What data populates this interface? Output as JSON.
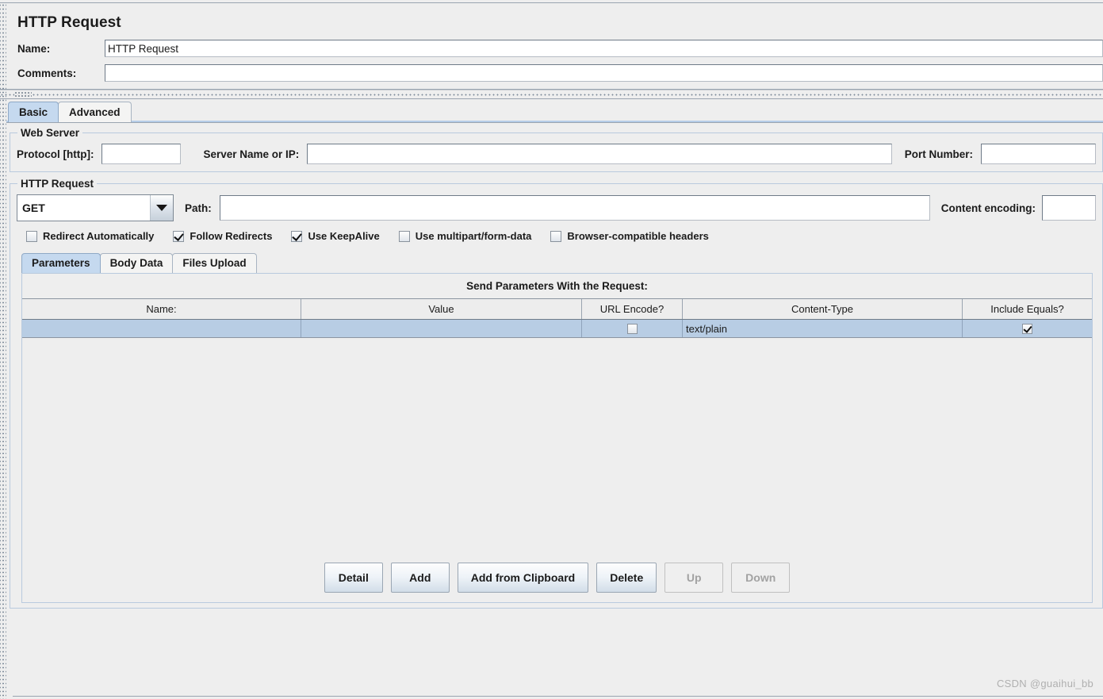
{
  "window": {
    "title": "HTTP Request"
  },
  "header": {
    "name_label": "Name:",
    "name_value": "HTTP Request",
    "comments_label": "Comments:",
    "comments_value": ""
  },
  "main_tabs": [
    {
      "label": "Basic",
      "selected": true
    },
    {
      "label": "Advanced",
      "selected": false
    }
  ],
  "web_server": {
    "legend": "Web Server",
    "protocol_label": "Protocol [http]:",
    "protocol_value": "",
    "server_label": "Server Name or IP:",
    "server_value": "",
    "port_label": "Port Number:",
    "port_value": ""
  },
  "http_request": {
    "legend": "HTTP Request",
    "method_value": "GET",
    "path_label": "Path:",
    "path_value": "",
    "content_encoding_label": "Content encoding:",
    "content_encoding_value": "",
    "checkboxes": [
      {
        "label": "Redirect Automatically",
        "checked": false
      },
      {
        "label": "Follow Redirects",
        "checked": true
      },
      {
        "label": "Use KeepAlive",
        "checked": true
      },
      {
        "label": "Use multipart/form-data",
        "checked": false
      },
      {
        "label": "Browser-compatible headers",
        "checked": false
      }
    ]
  },
  "inner_tabs": [
    {
      "label": "Parameters",
      "selected": true
    },
    {
      "label": "Body Data",
      "selected": false
    },
    {
      "label": "Files Upload",
      "selected": false
    }
  ],
  "parameters_panel": {
    "title": "Send Parameters With the Request:",
    "columns": [
      "Name:",
      "Value",
      "URL Encode?",
      "Content-Type",
      "Include Equals?"
    ],
    "rows": [
      {
        "name": "",
        "value": "",
        "url_encode": false,
        "content_type": "text/plain",
        "include_equals": true,
        "selected": true
      }
    ],
    "buttons": [
      {
        "label": "Detail",
        "enabled": true
      },
      {
        "label": "Add",
        "enabled": true
      },
      {
        "label": "Add from Clipboard",
        "enabled": true
      },
      {
        "label": "Delete",
        "enabled": true
      },
      {
        "label": "Up",
        "enabled": false
      },
      {
        "label": "Down",
        "enabled": false
      }
    ]
  },
  "watermark": {
    "text": "CSDN @guaihui_bb"
  },
  "colors": {
    "panel_bg": "#eeeeee",
    "tab_selected": "#c5d9ef",
    "row_selected": "#b8cde4",
    "border": "#9aa4b0",
    "group_border": "#b9cade"
  }
}
